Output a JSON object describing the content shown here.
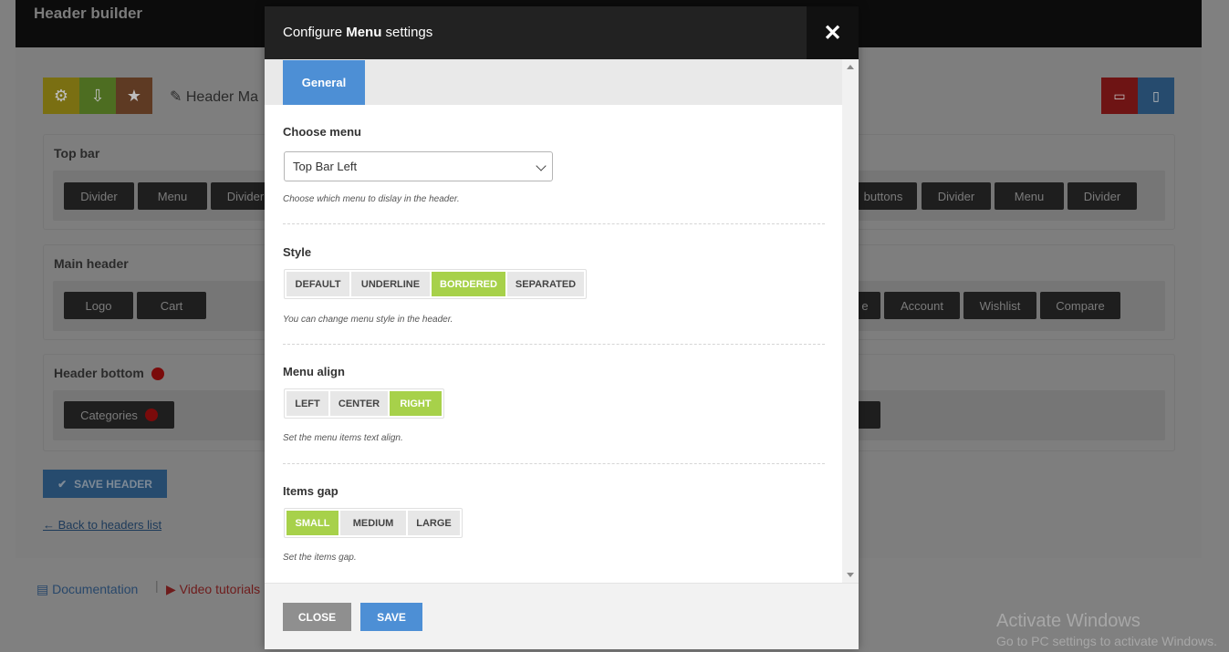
{
  "background": {
    "title": "Header builder",
    "header_name": "Header Ma",
    "sections": {
      "top_bar": {
        "title": "Top bar",
        "left_chips": [
          "Divider",
          "Menu",
          "Divider"
        ],
        "right_chips": [
          "buttons",
          "Divider",
          "Menu",
          "Divider"
        ]
      },
      "main_header": {
        "title": "Main header",
        "left_chips": [
          "Logo",
          "Cart"
        ],
        "right_chips": [
          "e",
          "Account",
          "Wishlist",
          "Compare"
        ]
      },
      "header_bottom": {
        "title": "Header bottom",
        "left_chips": [
          "Categories"
        ]
      }
    },
    "save_header": "SAVE HEADER",
    "back_link": "← Back to headers list",
    "footer": {
      "documentation": "Documentation",
      "video_tutorials": "Video tutorials"
    },
    "windows": {
      "line1": "Activate Windows",
      "line2": "Go to PC settings to activate Windows."
    }
  },
  "modal": {
    "title_prefix": "Configure ",
    "title_bold": "Menu",
    "title_suffix": " settings",
    "close_x": "✕",
    "tab": "General",
    "choose_menu": {
      "label": "Choose menu",
      "value": "Top Bar Left",
      "help": "Choose which menu to dislay in the header."
    },
    "style": {
      "label": "Style",
      "options": [
        "DEFAULT",
        "UNDERLINE",
        "BORDERED",
        "SEPARATED"
      ],
      "selected": "BORDERED",
      "help": "You can change menu style in the header."
    },
    "menu_align": {
      "label": "Menu align",
      "options": [
        "LEFT",
        "CENTER",
        "RIGHT"
      ],
      "selected": "RIGHT",
      "help": "Set the menu items text align."
    },
    "items_gap": {
      "label": "Items gap",
      "options": [
        "SMALL",
        "MEDIUM",
        "LARGE"
      ],
      "selected": "SMALL",
      "help": "Set the items gap."
    },
    "close_button": "CLOSE",
    "save_button": "SAVE"
  },
  "colors": {
    "accent_blue": "#4d8fd5",
    "active_green": "#a7d14a",
    "close_gray": "#8f8f8f"
  }
}
